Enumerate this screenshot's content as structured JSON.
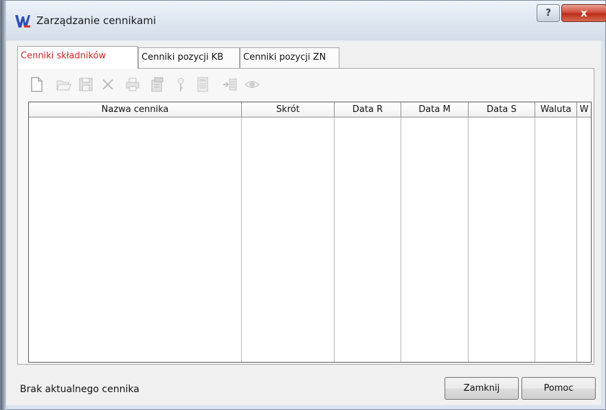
{
  "window": {
    "title": "Zarządzanie cennikami",
    "help_label": "?",
    "close_label": "x",
    "icon": "app-logo-icon"
  },
  "tabs": [
    {
      "label": "Cenniki składników",
      "active": true
    },
    {
      "label": "Cenniki pozycji KB",
      "active": false
    },
    {
      "label": "Cenniki pozycji ZN",
      "active": false
    }
  ],
  "toolbar": {
    "buttons": [
      {
        "icon": "new-document-icon",
        "enabled": true
      },
      {
        "icon": "open-folder-icon",
        "enabled": false
      },
      {
        "icon": "save-icon",
        "enabled": false
      },
      {
        "icon": "delete-icon",
        "enabled": false
      },
      {
        "icon": "print-icon",
        "enabled": false
      },
      {
        "icon": "properties-icon",
        "enabled": false
      },
      {
        "icon": "key-icon",
        "enabled": false
      },
      {
        "icon": "calculator-icon",
        "enabled": false
      },
      {
        "icon": "import-icon",
        "enabled": false
      },
      {
        "icon": "preview-eye-icon",
        "enabled": false
      }
    ]
  },
  "grid": {
    "columns": [
      "Nazwa cennika",
      "Skrót",
      "Data R",
      "Data M",
      "Data S",
      "Waluta",
      "W"
    ],
    "rows": []
  },
  "status": {
    "text": "Brak aktualnego cennika"
  },
  "buttons": {
    "close_label": "Zamknij",
    "help_label": "Pomoc"
  },
  "colors": {
    "active_tab_text": "#d81e1e",
    "close_button": "#c73a28",
    "title_bar": "#dfe7f1"
  }
}
